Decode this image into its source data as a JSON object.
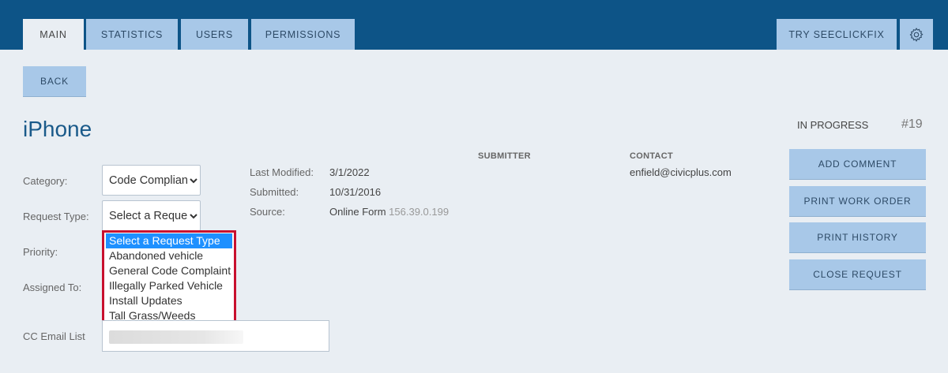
{
  "nav": {
    "tabs": [
      {
        "label": "MAIN",
        "active": true
      },
      {
        "label": "STATISTICS",
        "active": false
      },
      {
        "label": "USERS",
        "active": false
      },
      {
        "label": "PERMISSIONS",
        "active": false
      }
    ],
    "try_label": "TRY SEECLICKFIX",
    "settings_icon": "gear-icon"
  },
  "back_label": "BACK",
  "request": {
    "title": "iPhone",
    "status": "IN PROGRESS",
    "number": "#19"
  },
  "form": {
    "category_label": "Category:",
    "category_value": "Code Compliance",
    "request_type_label": "Request Type:",
    "request_type_value": "Select a Request Type",
    "priority_label": "Priority:",
    "assigned_label": "Assigned To:",
    "cc_label": "CC Email List",
    "request_type_options": [
      "Select a Request Type",
      "Abandoned vehicle",
      "General Code Complaint",
      "Illegally Parked Vehicle",
      "Install Updates",
      "Tall Grass/Weeds"
    ]
  },
  "meta": {
    "last_modified_label": "Last Modified:",
    "last_modified": "3/1/2022",
    "submitted_label": "Submitted:",
    "submitted": "10/31/2016",
    "source_label": "Source:",
    "source": "Online Form",
    "source_ip": "156.39.0.199"
  },
  "submitter_heading": "SUBMITTER",
  "contact": {
    "heading": "CONTACT",
    "email": "enfield@civicplus.com"
  },
  "actions": {
    "add_comment": "ADD COMMENT",
    "print_work_order": "PRINT WORK ORDER",
    "print_history": "PRINT HISTORY",
    "close_request": "CLOSE REQUEST"
  },
  "colors": {
    "header": "#0d5487",
    "tab": "#a8c8e8",
    "background": "#e9eef3",
    "title": "#1a5a8a",
    "highlight": "#c8102e",
    "selected_option": "#1e90ff"
  }
}
